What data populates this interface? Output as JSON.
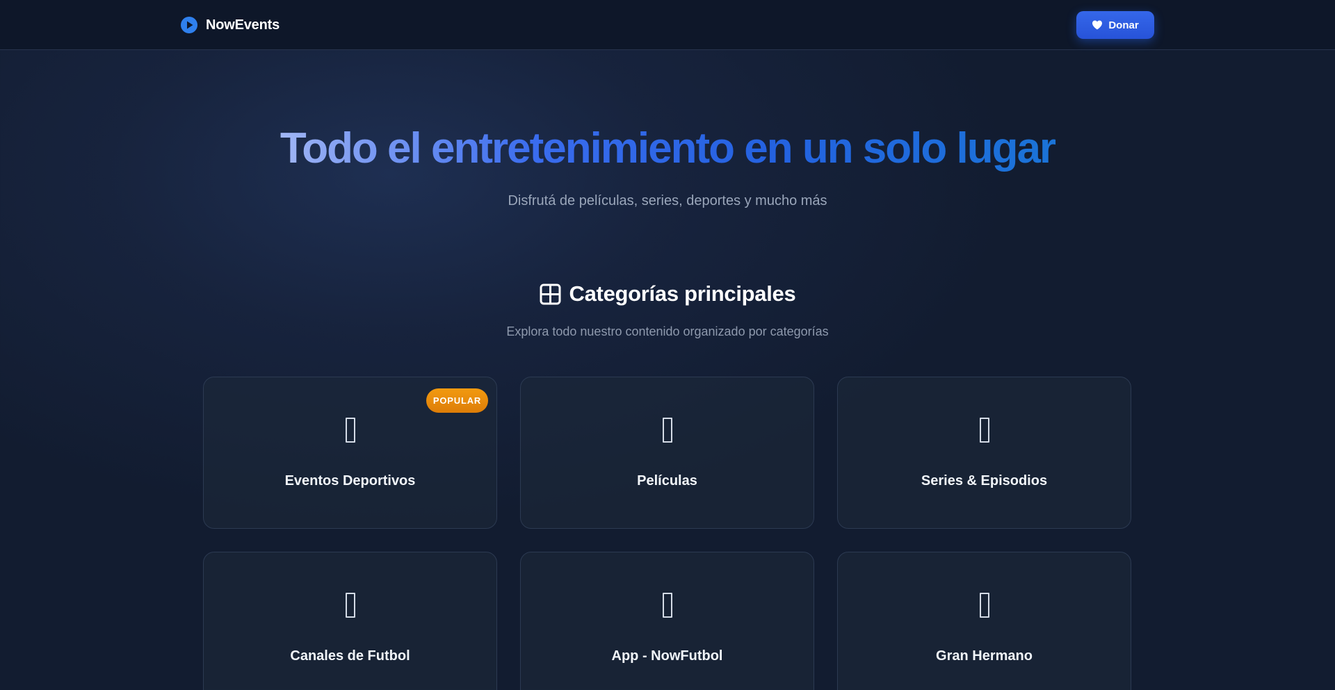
{
  "header": {
    "brand_name": "NowEvents",
    "donate_label": "Donar"
  },
  "hero": {
    "title": "Todo el entretenimiento en un solo lugar",
    "subtitle": "Disfrutá de películas, series, deportes y mucho más"
  },
  "categories_section": {
    "title": "Categorías principales",
    "subtitle": "Explora todo nuestro contenido organizado por categorías",
    "cards": [
      {
        "label": "Eventos Deportivos",
        "badge": "POPULAR",
        "icon": "missing-glyph-icon"
      },
      {
        "label": "Películas",
        "icon": "missing-glyph-icon"
      },
      {
        "label": "Series & Episodios",
        "icon": "missing-glyph-icon"
      },
      {
        "label": "Canales de Futbol",
        "icon": "missing-glyph-icon"
      },
      {
        "label": "App - NowFutbol",
        "icon": "missing-glyph-icon"
      },
      {
        "label": "Gran Hermano",
        "icon": "missing-glyph-icon"
      }
    ]
  },
  "colors": {
    "accent": "#2f5fe4",
    "badge": "#e8890c",
    "background": "#17233d",
    "header": "#0e1729"
  }
}
